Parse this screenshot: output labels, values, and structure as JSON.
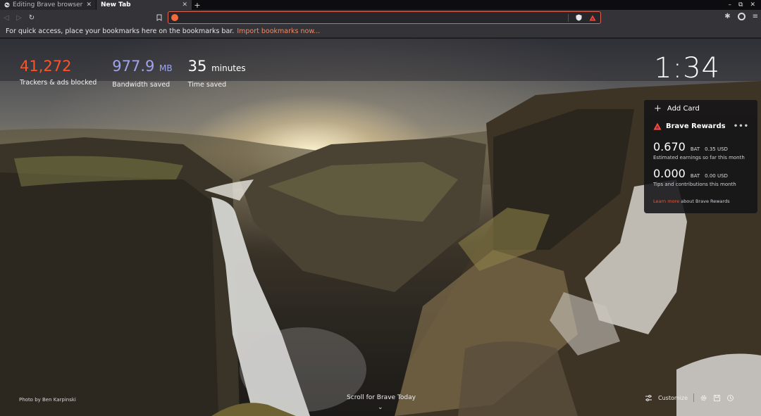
{
  "tabs": [
    {
      "title": "Editing Brave browser re",
      "active": false
    },
    {
      "title": "New Tab",
      "active": true
    }
  ],
  "window_controls": [
    "–",
    "⧉",
    "✕"
  ],
  "bookmarks_bar": {
    "message": "For quick access, place your bookmarks here on the bookmarks bar.",
    "link": "Import bookmarks now..."
  },
  "stats": {
    "trackers": {
      "value": "41,272",
      "label": "Trackers & ads blocked"
    },
    "bandwidth": {
      "value": "977.9",
      "unit": "MB",
      "label": "Bandwidth saved"
    },
    "time": {
      "value": "35",
      "unit": "minutes",
      "label": "Time saved"
    }
  },
  "clock": "1:34",
  "widgets": {
    "add_card": "Add Card",
    "rewards": {
      "title": "Brave Rewards",
      "more": "•••",
      "earnings": {
        "amount": "0.670",
        "currency": "BAT",
        "usd": "0.35 USD",
        "desc": "Estimated earnings so far this month"
      },
      "tips": {
        "amount": "0.000",
        "currency": "BAT",
        "usd": "0.00 USD",
        "desc": "Tips and contributions this month"
      },
      "learn_more_link": "Learn more",
      "learn_more_rest": "about Brave Rewards"
    }
  },
  "footer": {
    "photo_credit": "Photo by Ben Karpinski",
    "scroll_hint": "Scroll for Brave Today",
    "customize": "Customize"
  },
  "colors": {
    "brave_orange": "#fb542b",
    "bandwidth_purple": "#a0a5eb",
    "url_border": "#e0634f"
  }
}
